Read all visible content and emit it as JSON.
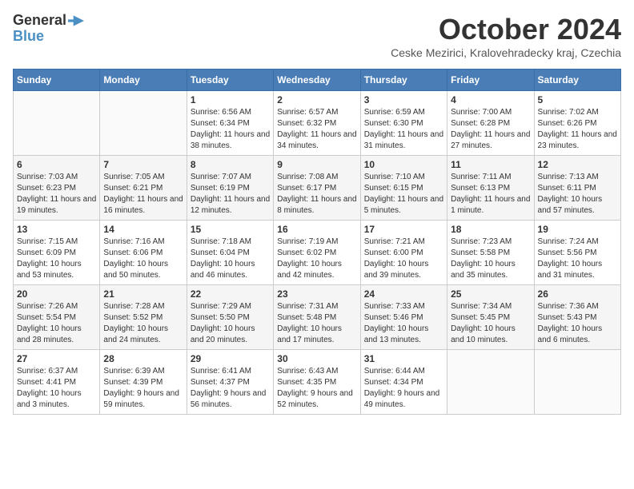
{
  "header": {
    "logo_general": "General",
    "logo_blue": "Blue",
    "month_title": "October 2024",
    "subtitle": "Ceske Mezirici, Kralovehradecky kraj, Czechia"
  },
  "weekdays": [
    "Sunday",
    "Monday",
    "Tuesday",
    "Wednesday",
    "Thursday",
    "Friday",
    "Saturday"
  ],
  "weeks": [
    [
      {
        "day": "",
        "info": ""
      },
      {
        "day": "",
        "info": ""
      },
      {
        "day": "1",
        "info": "Sunrise: 6:56 AM\nSunset: 6:34 PM\nDaylight: 11 hours and 38 minutes."
      },
      {
        "day": "2",
        "info": "Sunrise: 6:57 AM\nSunset: 6:32 PM\nDaylight: 11 hours and 34 minutes."
      },
      {
        "day": "3",
        "info": "Sunrise: 6:59 AM\nSunset: 6:30 PM\nDaylight: 11 hours and 31 minutes."
      },
      {
        "day": "4",
        "info": "Sunrise: 7:00 AM\nSunset: 6:28 PM\nDaylight: 11 hours and 27 minutes."
      },
      {
        "day": "5",
        "info": "Sunrise: 7:02 AM\nSunset: 6:26 PM\nDaylight: 11 hours and 23 minutes."
      }
    ],
    [
      {
        "day": "6",
        "info": "Sunrise: 7:03 AM\nSunset: 6:23 PM\nDaylight: 11 hours and 19 minutes."
      },
      {
        "day": "7",
        "info": "Sunrise: 7:05 AM\nSunset: 6:21 PM\nDaylight: 11 hours and 16 minutes."
      },
      {
        "day": "8",
        "info": "Sunrise: 7:07 AM\nSunset: 6:19 PM\nDaylight: 11 hours and 12 minutes."
      },
      {
        "day": "9",
        "info": "Sunrise: 7:08 AM\nSunset: 6:17 PM\nDaylight: 11 hours and 8 minutes."
      },
      {
        "day": "10",
        "info": "Sunrise: 7:10 AM\nSunset: 6:15 PM\nDaylight: 11 hours and 5 minutes."
      },
      {
        "day": "11",
        "info": "Sunrise: 7:11 AM\nSunset: 6:13 PM\nDaylight: 11 hours and 1 minute."
      },
      {
        "day": "12",
        "info": "Sunrise: 7:13 AM\nSunset: 6:11 PM\nDaylight: 10 hours and 57 minutes."
      }
    ],
    [
      {
        "day": "13",
        "info": "Sunrise: 7:15 AM\nSunset: 6:09 PM\nDaylight: 10 hours and 53 minutes."
      },
      {
        "day": "14",
        "info": "Sunrise: 7:16 AM\nSunset: 6:06 PM\nDaylight: 10 hours and 50 minutes."
      },
      {
        "day": "15",
        "info": "Sunrise: 7:18 AM\nSunset: 6:04 PM\nDaylight: 10 hours and 46 minutes."
      },
      {
        "day": "16",
        "info": "Sunrise: 7:19 AM\nSunset: 6:02 PM\nDaylight: 10 hours and 42 minutes."
      },
      {
        "day": "17",
        "info": "Sunrise: 7:21 AM\nSunset: 6:00 PM\nDaylight: 10 hours and 39 minutes."
      },
      {
        "day": "18",
        "info": "Sunrise: 7:23 AM\nSunset: 5:58 PM\nDaylight: 10 hours and 35 minutes."
      },
      {
        "day": "19",
        "info": "Sunrise: 7:24 AM\nSunset: 5:56 PM\nDaylight: 10 hours and 31 minutes."
      }
    ],
    [
      {
        "day": "20",
        "info": "Sunrise: 7:26 AM\nSunset: 5:54 PM\nDaylight: 10 hours and 28 minutes."
      },
      {
        "day": "21",
        "info": "Sunrise: 7:28 AM\nSunset: 5:52 PM\nDaylight: 10 hours and 24 minutes."
      },
      {
        "day": "22",
        "info": "Sunrise: 7:29 AM\nSunset: 5:50 PM\nDaylight: 10 hours and 20 minutes."
      },
      {
        "day": "23",
        "info": "Sunrise: 7:31 AM\nSunset: 5:48 PM\nDaylight: 10 hours and 17 minutes."
      },
      {
        "day": "24",
        "info": "Sunrise: 7:33 AM\nSunset: 5:46 PM\nDaylight: 10 hours and 13 minutes."
      },
      {
        "day": "25",
        "info": "Sunrise: 7:34 AM\nSunset: 5:45 PM\nDaylight: 10 hours and 10 minutes."
      },
      {
        "day": "26",
        "info": "Sunrise: 7:36 AM\nSunset: 5:43 PM\nDaylight: 10 hours and 6 minutes."
      }
    ],
    [
      {
        "day": "27",
        "info": "Sunrise: 6:37 AM\nSunset: 4:41 PM\nDaylight: 10 hours and 3 minutes."
      },
      {
        "day": "28",
        "info": "Sunrise: 6:39 AM\nSunset: 4:39 PM\nDaylight: 9 hours and 59 minutes."
      },
      {
        "day": "29",
        "info": "Sunrise: 6:41 AM\nSunset: 4:37 PM\nDaylight: 9 hours and 56 minutes."
      },
      {
        "day": "30",
        "info": "Sunrise: 6:43 AM\nSunset: 4:35 PM\nDaylight: 9 hours and 52 minutes."
      },
      {
        "day": "31",
        "info": "Sunrise: 6:44 AM\nSunset: 4:34 PM\nDaylight: 9 hours and 49 minutes."
      },
      {
        "day": "",
        "info": ""
      },
      {
        "day": "",
        "info": ""
      }
    ]
  ]
}
